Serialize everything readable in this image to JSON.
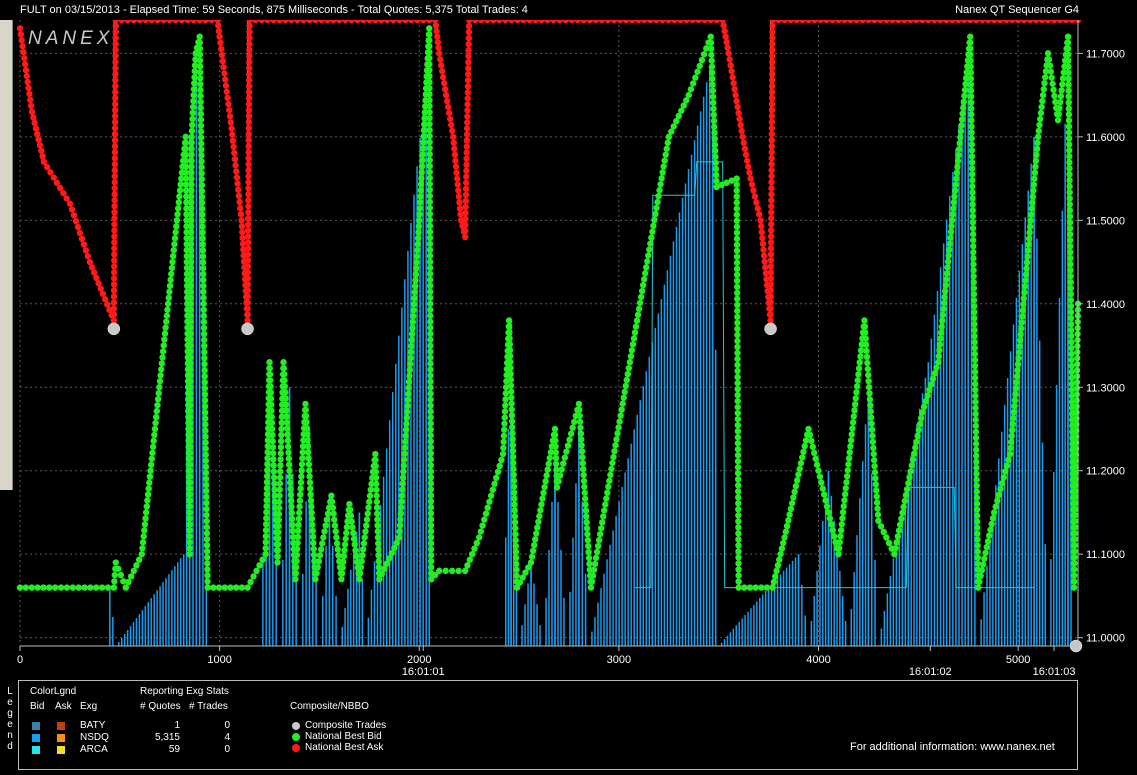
{
  "header": {
    "left": "FULT on 03/15/2013  -  Elapsed Time: 59 Seconds, 875 Milliseconds  -  Total Quotes: 5,375  Total Trades: 4",
    "right": "Nanex QT Sequencer G4",
    "logo": "NANEX"
  },
  "colors": {
    "bid": "#22ee22",
    "ask": "#ff1a1a",
    "nsdq_quote": "#1a9cf0",
    "arca_quote": "#21c8d8",
    "trade_line": "#ff8a1f",
    "trade_marker": "#c8c8c8",
    "grid": "#5a5a5a"
  },
  "chart_data": {
    "type": "line",
    "title": "",
    "xlabel": "",
    "ylabel": "",
    "xlim": [
      0,
      5300
    ],
    "ylim": [
      10.99,
      11.74
    ],
    "x_ticks": [
      "0",
      "1000",
      "2000",
      "3000",
      "4000",
      "5000"
    ],
    "x_tick_values": [
      0,
      1000,
      2000,
      3000,
      4000,
      5000
    ],
    "time_labels": [
      {
        "x": 2020,
        "label": "16:01:01"
      },
      {
        "x": 4560,
        "label": "16:01:02"
      },
      {
        "x": 5180,
        "label": "16:01:03"
      }
    ],
    "y_ticks": [
      "11.0000",
      "11.1000",
      "11.2000",
      "11.3000",
      "11.4000",
      "11.5000",
      "11.6000",
      "11.7000"
    ],
    "y_tick_values": [
      11.0,
      11.1,
      11.2,
      11.3,
      11.4,
      11.5,
      11.6,
      11.7
    ],
    "grid": true,
    "series": [
      {
        "name": "National Best Bid",
        "points": [
          [
            0,
            11.06
          ],
          [
            470,
            11.06
          ],
          [
            480,
            11.09
          ],
          [
            530,
            11.06
          ],
          [
            610,
            11.1
          ],
          [
            830,
            11.6
          ],
          [
            850,
            11.1
          ],
          [
            860,
            11.6
          ],
          [
            880,
            11.7
          ],
          [
            900,
            11.72
          ],
          [
            920,
            11.4
          ],
          [
            940,
            11.06
          ],
          [
            1140,
            11.06
          ],
          [
            1230,
            11.1
          ],
          [
            1250,
            11.33
          ],
          [
            1290,
            11.09
          ],
          [
            1320,
            11.33
          ],
          [
            1380,
            11.07
          ],
          [
            1430,
            11.28
          ],
          [
            1480,
            11.07
          ],
          [
            1560,
            11.17
          ],
          [
            1610,
            11.07
          ],
          [
            1650,
            11.16
          ],
          [
            1700,
            11.07
          ],
          [
            1780,
            11.22
          ],
          [
            1800,
            11.07
          ],
          [
            1900,
            11.12
          ],
          [
            2000,
            11.5
          ],
          [
            2050,
            11.73
          ],
          [
            2060,
            11.07
          ],
          [
            2100,
            11.08
          ],
          [
            2230,
            11.08
          ],
          [
            2300,
            11.12
          ],
          [
            2420,
            11.22
          ],
          [
            2450,
            11.38
          ],
          [
            2490,
            11.06
          ],
          [
            2560,
            11.09
          ],
          [
            2680,
            11.25
          ],
          [
            2690,
            11.18
          ],
          [
            2800,
            11.28
          ],
          [
            2860,
            11.06
          ],
          [
            3250,
            11.6
          ],
          [
            3350,
            11.65
          ],
          [
            3460,
            11.72
          ],
          [
            3490,
            11.54
          ],
          [
            3590,
            11.55
          ],
          [
            3600,
            11.06
          ],
          [
            3770,
            11.06
          ],
          [
            3830,
            11.12
          ],
          [
            3950,
            11.25
          ],
          [
            4100,
            11.1
          ],
          [
            4230,
            11.38
          ],
          [
            4300,
            11.14
          ],
          [
            4380,
            11.1
          ],
          [
            4520,
            11.27
          ],
          [
            4600,
            11.33
          ],
          [
            4760,
            11.72
          ],
          [
            4800,
            11.06
          ],
          [
            4880,
            11.15
          ],
          [
            4960,
            11.22
          ],
          [
            5100,
            11.6
          ],
          [
            5150,
            11.7
          ],
          [
            5200,
            11.62
          ],
          [
            5250,
            11.72
          ],
          [
            5280,
            11.06
          ],
          [
            5300,
            11.4
          ]
        ]
      },
      {
        "name": "National Best Ask",
        "points": [
          [
            0,
            11.73
          ],
          [
            60,
            11.63
          ],
          [
            120,
            11.57
          ],
          [
            250,
            11.52
          ],
          [
            350,
            11.45
          ],
          [
            470,
            11.38
          ],
          [
            480,
            11.74
          ],
          [
            990,
            11.74
          ],
          [
            1000,
            11.72
          ],
          [
            1060,
            11.61
          ],
          [
            1110,
            11.5
          ],
          [
            1140,
            11.38
          ],
          [
            1150,
            11.74
          ],
          [
            2080,
            11.74
          ],
          [
            2100,
            11.7
          ],
          [
            2170,
            11.6
          ],
          [
            2210,
            11.5
          ],
          [
            2230,
            11.48
          ],
          [
            2250,
            11.74
          ],
          [
            3520,
            11.74
          ],
          [
            3550,
            11.7
          ],
          [
            3620,
            11.6
          ],
          [
            3660,
            11.55
          ],
          [
            3710,
            11.5
          ],
          [
            3760,
            11.38
          ],
          [
            3770,
            11.74
          ],
          [
            5300,
            11.74
          ]
        ]
      },
      {
        "name": "NSDQ",
        "points": [
          [
            450,
            11.06
          ],
          [
            480,
            10.99
          ],
          [
            820,
            11.1
          ],
          [
            850,
            11.6
          ],
          [
            900,
            11.72
          ],
          [
            950,
            10.99
          ],
          [
            1200,
            10.99
          ],
          [
            1250,
            11.3
          ],
          [
            1300,
            10.99
          ],
          [
            1350,
            11.3
          ],
          [
            1400,
            10.99
          ],
          [
            1450,
            11.25
          ],
          [
            1500,
            10.99
          ],
          [
            1550,
            11.17
          ],
          [
            1600,
            10.99
          ],
          [
            1700,
            11.15
          ],
          [
            1730,
            10.99
          ],
          [
            2050,
            11.7
          ],
          [
            2070,
            10.99
          ],
          [
            2420,
            10.99
          ],
          [
            2460,
            11.38
          ],
          [
            2500,
            10.99
          ],
          [
            2560,
            11.09
          ],
          [
            2620,
            10.99
          ],
          [
            2680,
            11.22
          ],
          [
            2740,
            10.99
          ],
          [
            2800,
            11.25
          ],
          [
            2850,
            10.99
          ],
          [
            3470,
            11.7
          ],
          [
            3500,
            10.99
          ],
          [
            3750,
            11.06
          ],
          [
            3900,
            11.1
          ],
          [
            3950,
            10.99
          ],
          [
            4050,
            11.2
          ],
          [
            4150,
            10.99
          ],
          [
            4250,
            11.3
          ],
          [
            4300,
            10.99
          ],
          [
            4450,
            11.2
          ],
          [
            4550,
            11.33
          ],
          [
            4750,
            11.7
          ],
          [
            4800,
            10.99
          ],
          [
            5080,
            11.6
          ],
          [
            5150,
            10.99
          ],
          [
            5250,
            11.72
          ],
          [
            5280,
            10.99
          ]
        ]
      },
      {
        "name": "ARCA",
        "points": [
          [
            3080,
            11.06
          ],
          [
            3160,
            11.06
          ],
          [
            3170,
            11.53
          ],
          [
            3380,
            11.53
          ],
          [
            3390,
            11.57
          ],
          [
            3520,
            11.57
          ],
          [
            3530,
            11.06
          ],
          [
            4440,
            11.06
          ],
          [
            4450,
            11.18
          ],
          [
            4680,
            11.18
          ],
          [
            4690,
            11.06
          ],
          [
            4780,
            11.06
          ],
          [
            4790,
            11.06
          ],
          [
            4990,
            11.06
          ],
          [
            5000,
            11.06
          ],
          [
            5080,
            11.06
          ]
        ]
      }
    ],
    "trades": [
      {
        "x": 470,
        "y": 11.37
      },
      {
        "x": 1140,
        "y": 11.37
      },
      {
        "x": 3760,
        "y": 11.37
      },
      {
        "x": 5290,
        "y": 10.99
      }
    ]
  },
  "legend": {
    "vertical_label": "Legend",
    "color_legend_title": "ColorLgnd",
    "col_bid": "Bid",
    "col_ask": "Ask",
    "col_exg": "Exg",
    "stats_title": "Reporting Exg Stats",
    "col_quotes": "# Quotes",
    "col_trades": "# Trades",
    "rows": [
      {
        "exg": "BATY",
        "quotes": "1",
        "trades": "0",
        "bid_color": "#3c7fa8",
        "ask_color": "#c04010"
      },
      {
        "exg": "NSDQ",
        "quotes": "5,315",
        "trades": "4",
        "bid_color": "#1a9cf0",
        "ask_color": "#ff8a1f"
      },
      {
        "exg": "ARCA",
        "quotes": "59",
        "trades": "0",
        "bid_color": "#21e8f0",
        "ask_color": "#f0e020"
      }
    ],
    "composite_title": "Composite/NBBO",
    "composite_items": [
      {
        "label": "Composite Trades",
        "color": "#c8c8c8"
      },
      {
        "label": "National Best Bid",
        "color": "#22ee22"
      },
      {
        "label": "National Best Ask",
        "color": "#ff1a1a"
      }
    ],
    "info": "For additional information: www.nanex.net"
  }
}
